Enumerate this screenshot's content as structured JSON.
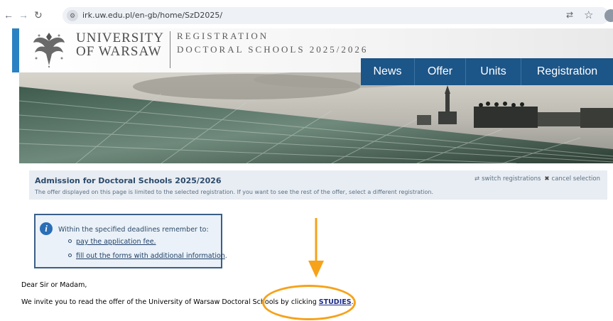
{
  "browser": {
    "url": "irk.uw.edu.pl/en-gb/home/SzD2025/",
    "back_icon": "arrow-left-icon",
    "forward_icon": "arrow-right-icon",
    "reload_icon": "reload-icon"
  },
  "header": {
    "uni_line1": "UNIVERSITY",
    "uni_line2": "OF WARSAW",
    "reg_line1": "REGISTRATION",
    "reg_line2": "DOCTORAL SCHOOLS 2025/2026"
  },
  "menu": {
    "items": [
      {
        "label": "News"
      },
      {
        "label": "Offer"
      },
      {
        "label": "Units"
      },
      {
        "label": "Registration"
      }
    ],
    "color": "#1c5588"
  },
  "admission": {
    "title": "Admission for Doctoral Schools 2025/2026",
    "description": "The offer displayed on this page is limited to the selected registration. If you want to see the rest of the offer, select a different registration.",
    "switch_label": "switch registrations",
    "cancel_label": "cancel selection"
  },
  "info": {
    "intro": "Within the specified deadlines remember to:",
    "items": [
      {
        "link": "pay the application fee.",
        "suffix": ""
      },
      {
        "link": "fill out the forms with additional information",
        "suffix": "."
      }
    ]
  },
  "body": {
    "greeting": "Dear Sir or Madam,",
    "invite_prefix": "We invite you to read the offer of the University of Warsaw Doctoral Schools by clicking ",
    "studies_link": "STUDIES",
    "invite_suffix": "."
  },
  "annotation": {
    "color": "#f6a21a"
  }
}
